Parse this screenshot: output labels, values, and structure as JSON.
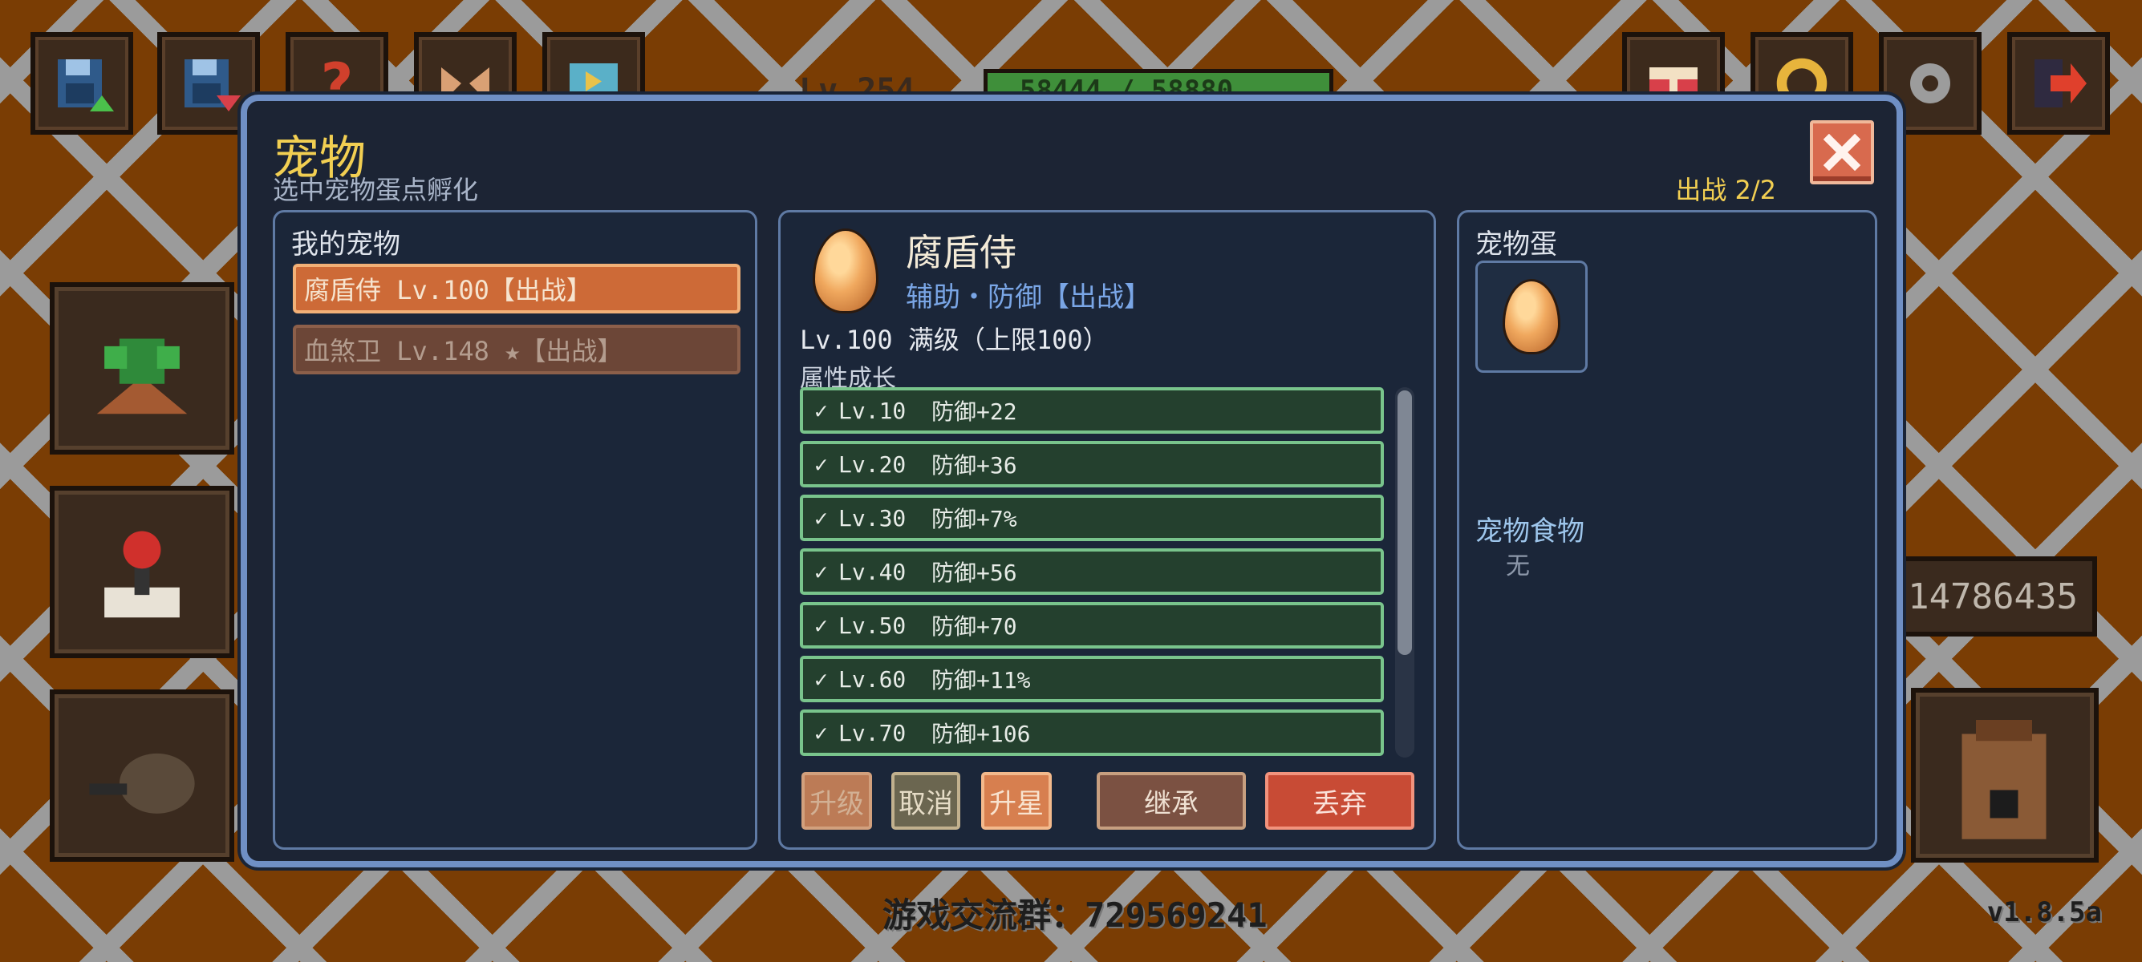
{
  "hud": {
    "level_text": "Lv.254",
    "exp_text": "58444 / 58880",
    "coins": "14786435",
    "footer_group": "游戏交流群：729569241",
    "version": "v1.8.5a"
  },
  "dialog": {
    "title": "宠物",
    "subtitle": "选中宠物蛋点孵化",
    "deploy_count": "出战 2/2",
    "close_icon": "close-icon"
  },
  "my_pets": {
    "label": "我的宠物",
    "items": [
      {
        "text": "腐盾侍 Lv.100【出战】",
        "active": true
      },
      {
        "text": "血煞卫 Lv.148 ★【出战】",
        "active": false
      }
    ]
  },
  "detail": {
    "name": "腐盾侍",
    "type": "辅助・防御【出战】",
    "level": "Lv.100 满级（上限100）",
    "growth_label": "属性成长",
    "growth": [
      {
        "check": "✓",
        "lv": "Lv.10",
        "stat": "防御+22"
      },
      {
        "check": "✓",
        "lv": "Lv.20",
        "stat": "防御+36"
      },
      {
        "check": "✓",
        "lv": "Lv.30",
        "stat": "防御+7%"
      },
      {
        "check": "✓",
        "lv": "Lv.40",
        "stat": "防御+56"
      },
      {
        "check": "✓",
        "lv": "Lv.50",
        "stat": "防御+70"
      },
      {
        "check": "✓",
        "lv": "Lv.60",
        "stat": "防御+11%"
      },
      {
        "check": "✓",
        "lv": "Lv.70",
        "stat": "防御+106"
      }
    ],
    "buttons": {
      "upgrade": "升级",
      "cancel": "取消",
      "star": "升星",
      "inherit": "继承",
      "discard": "丢弃"
    }
  },
  "right_panel": {
    "egg_label": "宠物蛋",
    "food_label": "宠物食物",
    "food_value": "无"
  },
  "colors": {
    "accent_gold": "#f2cf52",
    "dialog_border": "#6f8fc4",
    "growth_border": "#79c48c",
    "discard_red": "#c84b35"
  }
}
